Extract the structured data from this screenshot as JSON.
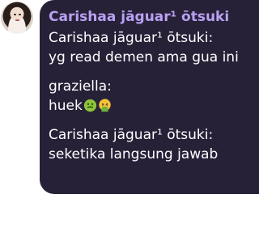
{
  "avatar": {
    "icon": "profile-photo"
  },
  "bubble": {
    "sender": "Carishaa jāguar¹ ōtsuki",
    "lines": [
      "Carishaa jāguar¹ ōtsuki:",
      "yg read demen ama gua ini",
      "graziella:",
      "huek",
      "Carishaa jāguar¹ ōtsuki:",
      "seketika langsung jawab"
    ],
    "emojis": [
      "nauseated-face-emoji",
      "vomiting-face-emoji"
    ]
  },
  "colors": {
    "bubble_bg": "#272138",
    "sender_name": "#b9a1f2",
    "text": "#ffffff"
  }
}
